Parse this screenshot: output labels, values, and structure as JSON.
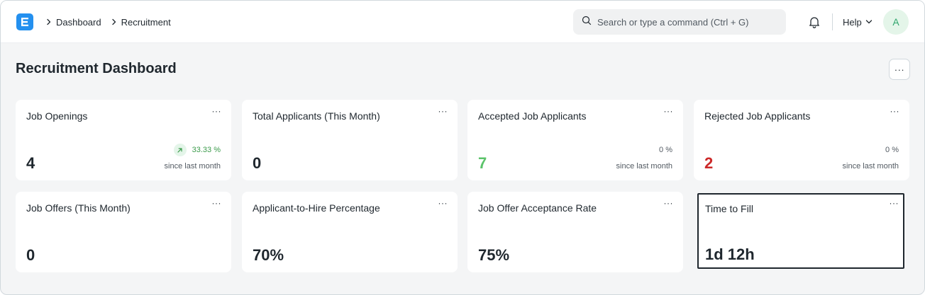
{
  "navbar": {
    "breadcrumbs": [
      {
        "label": "Dashboard"
      },
      {
        "label": "Recruitment"
      }
    ],
    "search_placeholder": "Search or type a command (Ctrl + G)",
    "help_label": "Help",
    "avatar_initial": "A"
  },
  "page": {
    "title": "Recruitment Dashboard",
    "menu_label": "···"
  },
  "colors": {
    "accent": "#2490ef",
    "positive": "#5bc36a",
    "negative": "#cc2929",
    "trend_up": "#3b9b4b"
  },
  "cards": [
    {
      "title": "Job Openings",
      "menu": "···",
      "value": "4",
      "trend": "33.33 %",
      "trend_direction": "up",
      "since": "since last month"
    },
    {
      "title": "Total Applicants (This Month)",
      "menu": "···",
      "value": "0"
    },
    {
      "title": "Accepted Job Applicants",
      "menu": "···",
      "value": "7",
      "value_color": "green",
      "trend": "0 %",
      "since": "since last month"
    },
    {
      "title": "Rejected Job Applicants",
      "menu": "···",
      "value": "2",
      "value_color": "red",
      "trend": "0 %",
      "since": "since last month"
    },
    {
      "title": "Job Offers (This Month)",
      "menu": "···",
      "value": "0"
    },
    {
      "title": "Applicant-to-Hire Percentage",
      "menu": "···",
      "value": "70%"
    },
    {
      "title": "Job Offer Acceptance Rate",
      "menu": "···",
      "value": "75%"
    },
    {
      "title": "Time to Fill",
      "menu": "···",
      "value": "1d 12h",
      "selected": true
    }
  ]
}
